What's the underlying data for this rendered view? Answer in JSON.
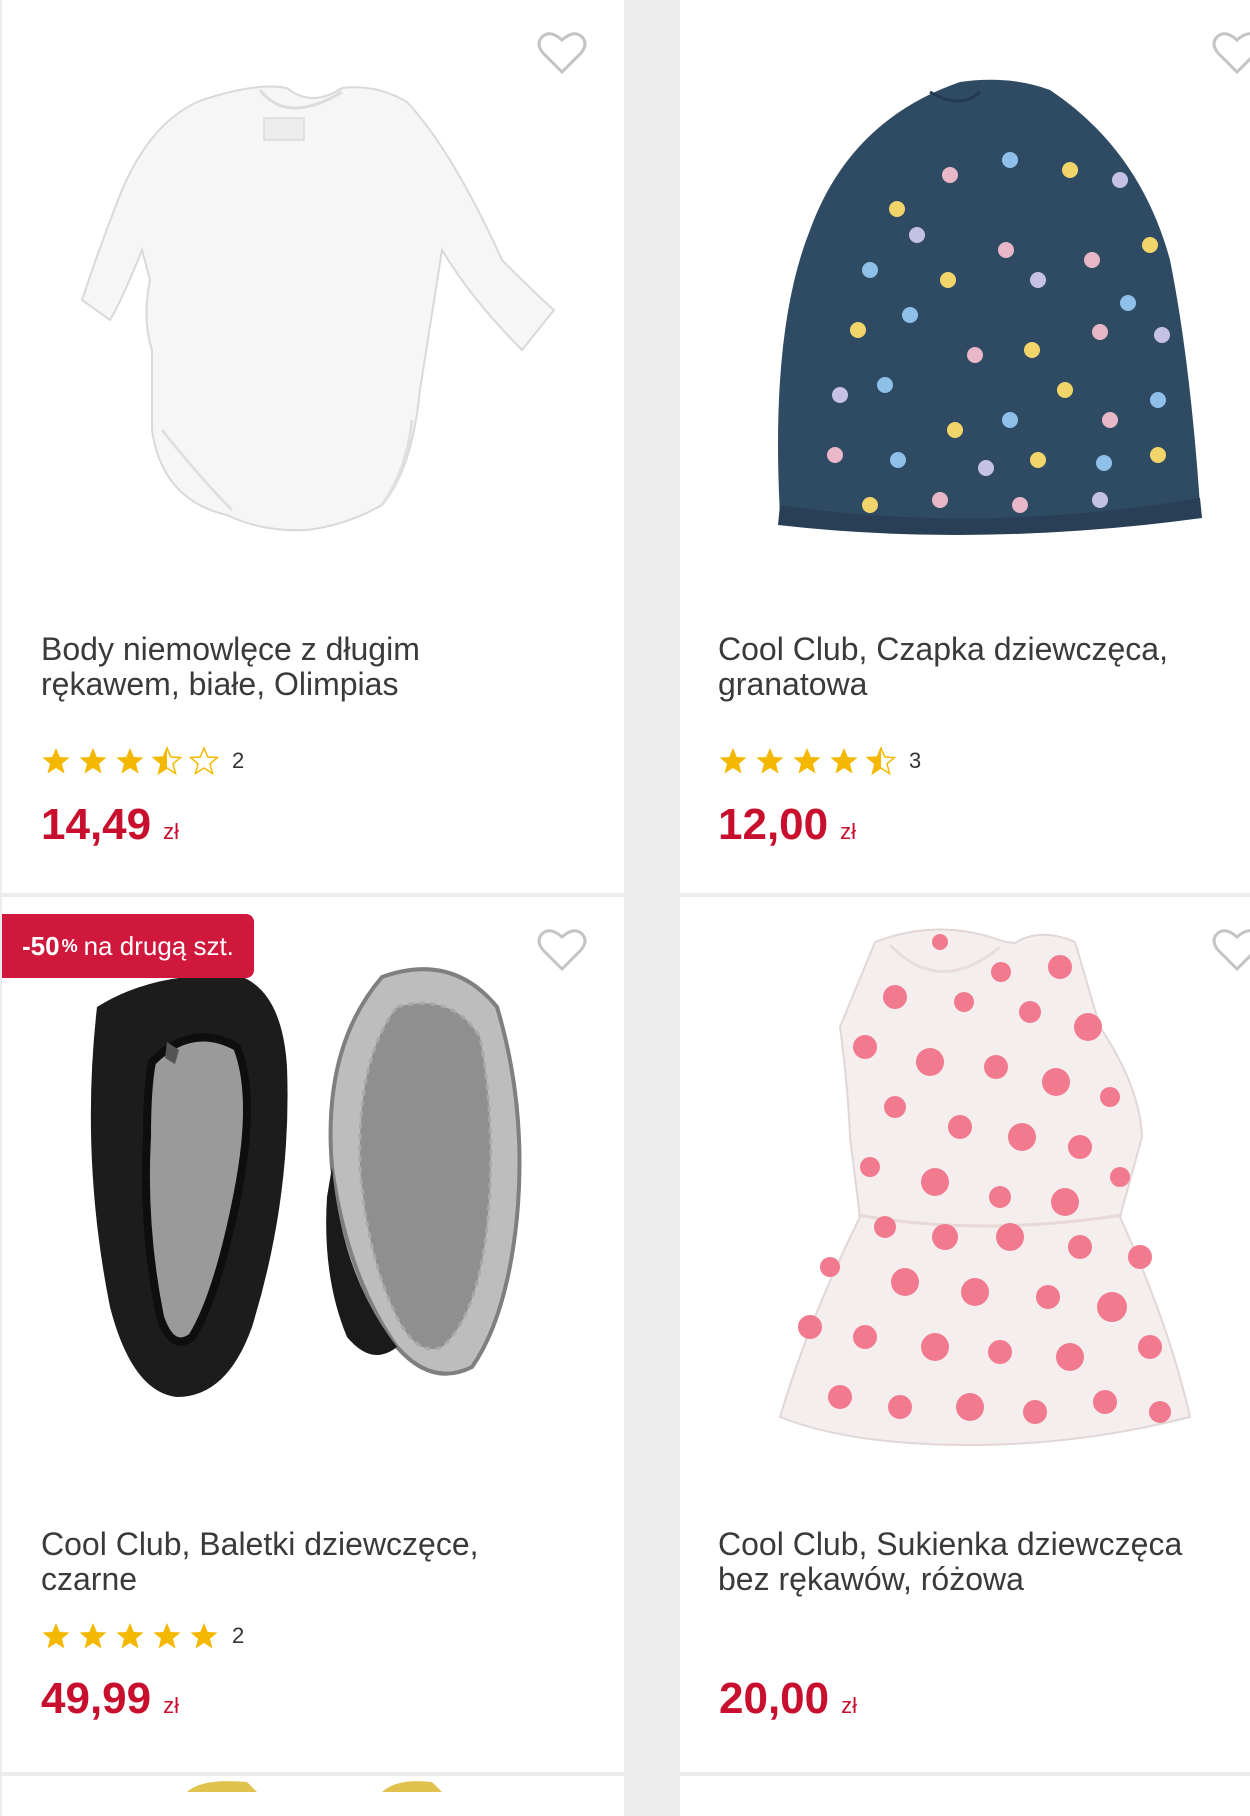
{
  "products": [
    {
      "title_line1": "Body niemowlęce z długim",
      "title_line2": "rękawem, białe, Olimpias",
      "rating_stars": 3.5,
      "rating_count": "2",
      "price": "14,49",
      "currency": "zł",
      "image_icon": "white-baby-bodysuit-image"
    },
    {
      "title_line1": "Cool Club, Czapka dziewczęca,",
      "title_line2": "granatowa",
      "rating_stars": 4.5,
      "rating_count": "3",
      "price": "12,00",
      "currency": "zł",
      "image_icon": "navy-polka-dot-hat-image"
    },
    {
      "badge": {
        "bold": "-50",
        "pct": "%",
        "text": "na drugą szt."
      },
      "title_line1": "Cool Club, Baletki dziewczęce,",
      "title_line2": "czarne",
      "rating_stars": 5,
      "rating_count": "2",
      "price": "49,99",
      "currency": "zł",
      "image_icon": "black-ballet-shoes-image"
    },
    {
      "title_line1": "Cool Club, Sukienka dziewczęca",
      "title_line2": "bez rękawów, różowa",
      "price": "20,00",
      "currency": "zł",
      "image_icon": "pink-polka-dot-dress-image"
    }
  ],
  "colors": {
    "price": "#c8102e",
    "badge": "#d0173c",
    "star": "#f5b800",
    "background": "#ececec"
  }
}
